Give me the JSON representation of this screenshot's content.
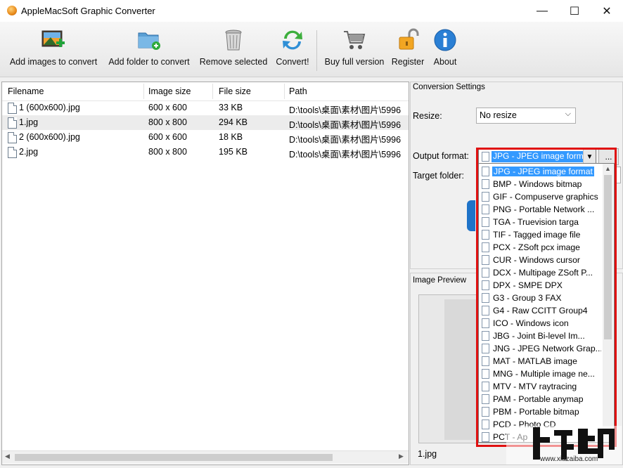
{
  "window": {
    "title": "AppleMacSoft Graphic Converter",
    "min_glyph": "—",
    "max_glyph": "☐",
    "close_glyph": "✕"
  },
  "toolbar": {
    "add_images": "Add images to convert",
    "add_folder": "Add folder to convert",
    "remove_selected": "Remove selected",
    "convert": "Convert!",
    "buy_full": "Buy full version",
    "register": "Register",
    "about": "About"
  },
  "filelist": {
    "columns": [
      "Filename",
      "Image size",
      "File size",
      "Path"
    ],
    "rows": [
      {
        "name": "1 (600x600).jpg",
        "size": "600 x 600",
        "filesize": "33 KB",
        "path": "D:\\tools\\桌面\\素材\\图片\\5996"
      },
      {
        "name": "1.jpg",
        "size": "800 x 800",
        "filesize": "294 KB",
        "path": "D:\\tools\\桌面\\素材\\图片\\5996"
      },
      {
        "name": "2 (600x600).jpg",
        "size": "600 x 600",
        "filesize": "18 KB",
        "path": "D:\\tools\\桌面\\素材\\图片\\5996"
      },
      {
        "name": "2.jpg",
        "size": "800 x 800",
        "filesize": "195 KB",
        "path": "D:\\tools\\桌面\\素材\\图片\\5996"
      }
    ],
    "selected_row": 1
  },
  "settings": {
    "title": "Conversion Settings",
    "resize_label": "Resize:",
    "resize_value": "No resize",
    "output_label": "Output format:",
    "output_value": "JPG - JPEG image format",
    "target_label": "Target folder:",
    "browse_label": "..."
  },
  "format_options": [
    "JPG - JPEG image format",
    "BMP - Windows bitmap",
    "GIF - Compuserve graphics",
    "PNG - Portable Network ...",
    "TGA - Truevision targa",
    "TIF - Tagged image file",
    "PCX - ZSoft pcx image",
    "CUR - Windows cursor",
    "DCX - Multipage ZSoft P...",
    "DPX - SMPE DPX",
    "G3 - Group 3 FAX",
    "G4 - Raw CCITT Group4",
    "ICO - Windows icon",
    "JBG - Joint Bi-level Im...",
    "JNG - JPEG Network Grap...",
    "MAT - MATLAB image",
    "MNG - Multiple image ne...",
    "MTV - MTV raytracing",
    "PAM - Portable anymap",
    "PBM - Portable bitmap",
    "PCD - Photo CD",
    "PCT - Ap"
  ],
  "preview": {
    "title": "Image Preview",
    "filename": "1.jpg"
  },
  "watermark": {
    "url": "www.xiazaiba.com"
  },
  "colors": {
    "highlight": "#3399ff",
    "red_frame": "#e01010"
  }
}
